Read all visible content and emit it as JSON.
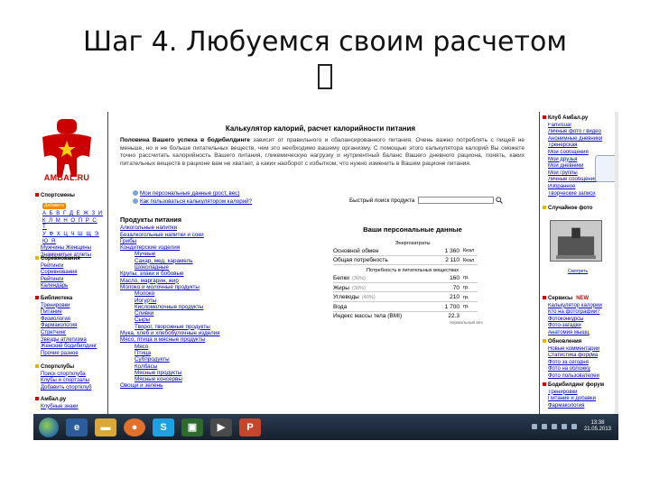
{
  "slide": {
    "title": "Шаг 4. Любуемся своим расчетом"
  },
  "site": {
    "logo_text": "AMBAL.RU",
    "left": {
      "sections": [
        {
          "title": "Спортсмены",
          "marker": "red"
        },
        {
          "title": "Соревнования",
          "marker": "yel"
        },
        {
          "title": "Библиотека",
          "marker": "red"
        },
        {
          "title": "Спортклубы",
          "marker": "yel"
        },
        {
          "title": "Амбал.ру",
          "marker": "red"
        }
      ],
      "badge": "Добавить",
      "alphabet": [
        "А Б В Г Д Е Ж З И",
        "К Л М Н О П Р С Т",
        "У Ф Х Ц Ч Ш Щ Э Ю Я"
      ],
      "athletes": [
        "Мужчины  Женщины",
        "Знаменитые атлеты"
      ],
      "competitions": [
        "Рейтинги",
        "Соревнования",
        "Рейтинги",
        "Календарь"
      ],
      "library": [
        "Тренировки",
        "Питание",
        "Физиология",
        "Фармакология",
        "Стретчинг",
        "Звезды атлетизма",
        "Женский бодибилдинг",
        "Прочие разное"
      ],
      "clubs": [
        "Поиск спортклуба",
        "Клубы и спортзалы",
        "Добавить спортклуб"
      ],
      "ambal": [
        "Клубные знаки"
      ]
    },
    "center": {
      "title": "Калькулятор калорий, расчет калорийности питания",
      "intro_bold": "Половина Вашего успеха в бодибилдинге",
      "intro_rest": " зависит от правильного и сбалансированного питания. Очень важно потреблять с пищей не меньше, но и не больше питательных веществ, чем это необходимо вашему организму. С помощью этого калькулятора калорий Вы сможете точно рассчитать калорийность Вашего питания, гликемическую нагрузку и нутриентный баланс Вашего дневного рациона, понять, каких питательных веществ в рационе вам не хватает, а каких наоборот с избытком, что нужно изменить в Вашем рационе питания.",
      "links": [
        "Мои персональные данные (рост, вес)",
        "Как пользоваться калькулятором калорий?"
      ],
      "search_label": "Быстрый поиск продукта",
      "products_title": "Продукты питания",
      "products": [
        {
          "t": "Алкогольные напитки",
          "sub": false
        },
        {
          "t": "Безалкогольные напитки и соки",
          "sub": false
        },
        {
          "t": "Грибы",
          "sub": false
        },
        {
          "t": "Кондитерские изделия",
          "sub": false
        },
        {
          "t": "Мучные",
          "sub": true
        },
        {
          "t": "Сахар, мед, карамель",
          "sub": true
        },
        {
          "t": "Шоколадные",
          "sub": true
        },
        {
          "t": "Крупы, злаки и бобовые",
          "sub": false
        },
        {
          "t": "Масло, маргарин, жир",
          "sub": false
        },
        {
          "t": "Молоко и молочные продукты",
          "sub": false
        },
        {
          "t": "Молоко",
          "sub": true
        },
        {
          "t": "Йогурты",
          "sub": true
        },
        {
          "t": "Кисломолочные продукты",
          "sub": true
        },
        {
          "t": "Сливки",
          "sub": true
        },
        {
          "t": "Сыры",
          "sub": true
        },
        {
          "t": "Творог, творожные продукты",
          "sub": true
        },
        {
          "t": "Мука, хлеб и хлебобулочные изделия",
          "sub": false
        },
        {
          "t": "Мясо, птица и мясные продукты",
          "sub": false
        },
        {
          "t": "Мясо",
          "sub": true
        },
        {
          "t": "Птица",
          "sub": true
        },
        {
          "t": "Субпродукты",
          "sub": true
        },
        {
          "t": "Колбасы",
          "sub": true
        },
        {
          "t": "Мясные продукты",
          "sub": true
        },
        {
          "t": "Мясные консервы",
          "sub": true
        },
        {
          "t": "Овощи и зелень",
          "sub": false
        }
      ],
      "personal": {
        "title": "Ваши персональные данные",
        "energy_label": "Энергозатраты",
        "energy": [
          {
            "label": "Основной обмен",
            "value": "1 360",
            "unit": "Ккал"
          },
          {
            "label": "Общая потребность",
            "value": "2 110",
            "unit": "Ккал"
          }
        ],
        "nutrients_label": "Потребность в питательных веществах",
        "nutrients": [
          {
            "label": "Белки",
            "pct": "(30%)",
            "value": "160",
            "unit": "гр."
          },
          {
            "label": "Жиры",
            "pct": "(30%)",
            "value": "70",
            "unit": "гр."
          },
          {
            "label": "Углеводы",
            "pct": "(40%)",
            "value": "210",
            "unit": "гр."
          },
          {
            "label": "Вода",
            "pct": "",
            "value": "1 700",
            "unit": "гр."
          },
          {
            "label": "Индекс массы тела (ВМI)",
            "pct": "",
            "value": "22.3",
            "unit": ""
          }
        ],
        "note": "нормальный вес"
      }
    },
    "right": {
      "club_title": "Клуб Амбал.ру",
      "club": [
        "Fanvisual",
        "Личные фото / видео",
        "Анонимные дневники",
        "Тренерская",
        "Мои сообщения",
        "Мои друзья",
        "Мои дневники",
        "Мои группы",
        "Личные сообщения",
        "Избранное",
        "Творческие записи"
      ],
      "photo_title": "Случайное фото",
      "photo_link": "Смотреть",
      "services_title": "Сервисы",
      "services_new": "NEW",
      "services": [
        "Калькулятор калорий",
        "Кто на фотографии?",
        "Фотоконкурсы",
        "Фото-загадки",
        "Анатомия мышц"
      ],
      "updates_title": "Обновления",
      "updates": [
        "Новые комментарии",
        "Статистика форума",
        "Фото за сегодня",
        "Фото на обложку",
        "Фото пользователей"
      ],
      "forum_title": "Бодибилдинг форум",
      "forum": [
        "Тренировки",
        "Питание и добавки",
        "Фармакология"
      ]
    },
    "taskbar": {
      "clock_time": "13:38",
      "clock_date": "21.05.2013"
    }
  }
}
